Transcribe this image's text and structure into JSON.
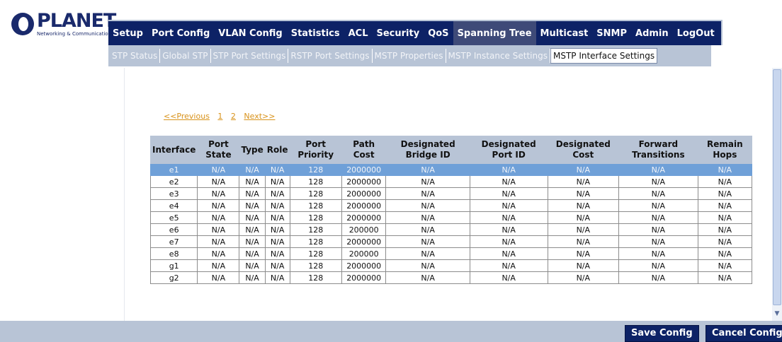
{
  "brand": {
    "name": "PLANET",
    "tagline": "Networking & Communication"
  },
  "main_nav": [
    {
      "label": "Setup"
    },
    {
      "label": "Port Config"
    },
    {
      "label": "VLAN Config"
    },
    {
      "label": "Statistics"
    },
    {
      "label": "ACL"
    },
    {
      "label": "Security"
    },
    {
      "label": "QoS"
    },
    {
      "label": "Spanning Tree",
      "active": true
    },
    {
      "label": "Multicast"
    },
    {
      "label": "SNMP"
    },
    {
      "label": "Admin"
    },
    {
      "label": "LogOut"
    }
  ],
  "sub_nav": [
    {
      "label": "STP Status"
    },
    {
      "label": "Global STP"
    },
    {
      "label": "STP Port Settings"
    },
    {
      "label": "RSTP Port Settings"
    },
    {
      "label": "MSTP Properties"
    },
    {
      "label": "MSTP Instance Settings"
    },
    {
      "label": "MSTP Interface Settings",
      "active": true
    }
  ],
  "pager": {
    "prev": "<<Previous",
    "pages": [
      "1",
      "2"
    ],
    "next": "Next>>"
  },
  "table": {
    "headers": [
      "Interface",
      "Port State",
      "Type",
      "Role",
      "Port Priority",
      "Path Cost",
      "Designated Bridge ID",
      "Designated Port ID",
      "Designated Cost",
      "Forward Transitions",
      "Remain Hops"
    ],
    "rows": [
      [
        "e1",
        "N/A",
        "N/A",
        "N/A",
        "128",
        "2000000",
        "N/A",
        "N/A",
        "N/A",
        "N/A",
        "N/A"
      ],
      [
        "e2",
        "N/A",
        "N/A",
        "N/A",
        "128",
        "2000000",
        "N/A",
        "N/A",
        "N/A",
        "N/A",
        "N/A"
      ],
      [
        "e3",
        "N/A",
        "N/A",
        "N/A",
        "128",
        "2000000",
        "N/A",
        "N/A",
        "N/A",
        "N/A",
        "N/A"
      ],
      [
        "e4",
        "N/A",
        "N/A",
        "N/A",
        "128",
        "2000000",
        "N/A",
        "N/A",
        "N/A",
        "N/A",
        "N/A"
      ],
      [
        "e5",
        "N/A",
        "N/A",
        "N/A",
        "128",
        "2000000",
        "N/A",
        "N/A",
        "N/A",
        "N/A",
        "N/A"
      ],
      [
        "e6",
        "N/A",
        "N/A",
        "N/A",
        "128",
        "200000",
        "N/A",
        "N/A",
        "N/A",
        "N/A",
        "N/A"
      ],
      [
        "e7",
        "N/A",
        "N/A",
        "N/A",
        "128",
        "2000000",
        "N/A",
        "N/A",
        "N/A",
        "N/A",
        "N/A"
      ],
      [
        "e8",
        "N/A",
        "N/A",
        "N/A",
        "128",
        "200000",
        "N/A",
        "N/A",
        "N/A",
        "N/A",
        "N/A"
      ],
      [
        "g1",
        "N/A",
        "N/A",
        "N/A",
        "128",
        "2000000",
        "N/A",
        "N/A",
        "N/A",
        "N/A",
        "N/A"
      ],
      [
        "g2",
        "N/A",
        "N/A",
        "N/A",
        "128",
        "2000000",
        "N/A",
        "N/A",
        "N/A",
        "N/A",
        "N/A"
      ]
    ],
    "selected_row": 0
  },
  "buttons": {
    "save": "Save Config",
    "cancel": "Cancel Config"
  },
  "colors": {
    "navy": "#0d2266",
    "lavender": "#b8c4d6",
    "selected_row": "#6fa0d8",
    "pager_link": "#d8921a"
  }
}
